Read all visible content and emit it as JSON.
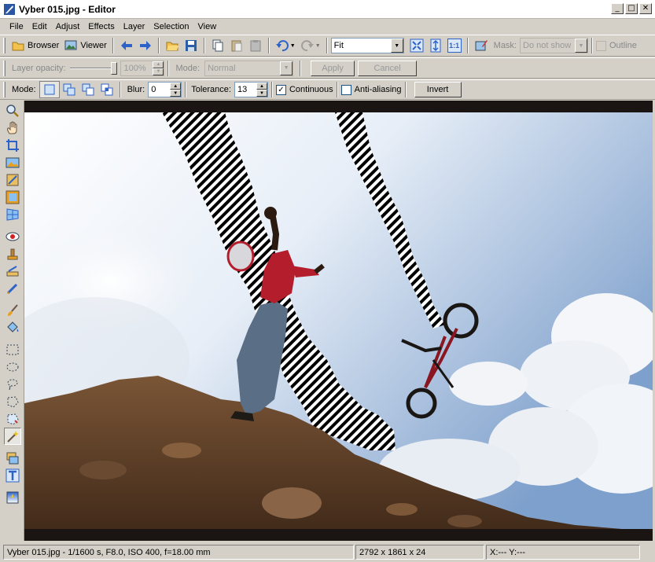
{
  "window": {
    "title": "Vyber 015.jpg - Editor"
  },
  "menu": [
    "File",
    "Edit",
    "Adjust",
    "Effects",
    "Layer",
    "Selection",
    "View"
  ],
  "toolbar1": {
    "browser_label": "Browser",
    "viewer_label": "Viewer",
    "zoom_value": "Fit",
    "fit_label": "1:1",
    "mask_label": "Mask:",
    "mask_value": "Do not show",
    "outline_label": "Outline"
  },
  "toolbar2": {
    "opacity_label": "Layer opacity:",
    "opacity_value": "100%",
    "mode_label": "Mode:",
    "mode_value": "Normal",
    "apply_label": "Apply",
    "cancel_label": "Cancel"
  },
  "toolbar3": {
    "mode_label": "Mode:",
    "blur_label": "Blur:",
    "blur_value": "0",
    "tolerance_label": "Tolerance:",
    "tolerance_value": "13",
    "continuous_label": "Continuous",
    "continuous_checked": true,
    "antialias_label": "Anti-aliasing",
    "antialias_checked": false,
    "invert_label": "Invert"
  },
  "tools": [
    "zoom-tool",
    "hand-tool",
    "crop-tool",
    "image-tool",
    "straighten-tool",
    "frame-tool",
    "perspective-tool",
    "red-eye-tool",
    "clone-stamp-tool",
    "heal-tool",
    "retouch-tool",
    "brush-tool",
    "fill-tool",
    "rectangle-select-tool",
    "ellipse-select-tool",
    "lasso-tool",
    "polygon-lasso-tool",
    "magnetic-lasso-tool",
    "magic-wand-tool",
    "layer-tool",
    "text-tool",
    "gradient-tool"
  ],
  "active_tool": "magic-wand-tool",
  "status": {
    "file_info": "Vyber 015.jpg - 1/1600 s, F8.0, ISO 400, f=18.00 mm",
    "dimensions": "2792 x 1861 x 24",
    "coords": "X:---  Y:---"
  },
  "colors": {
    "sky_top": "#7fa2cf",
    "dirt": "#5a3b24",
    "shirt": "#b31d2c",
    "selection": "#000000"
  }
}
